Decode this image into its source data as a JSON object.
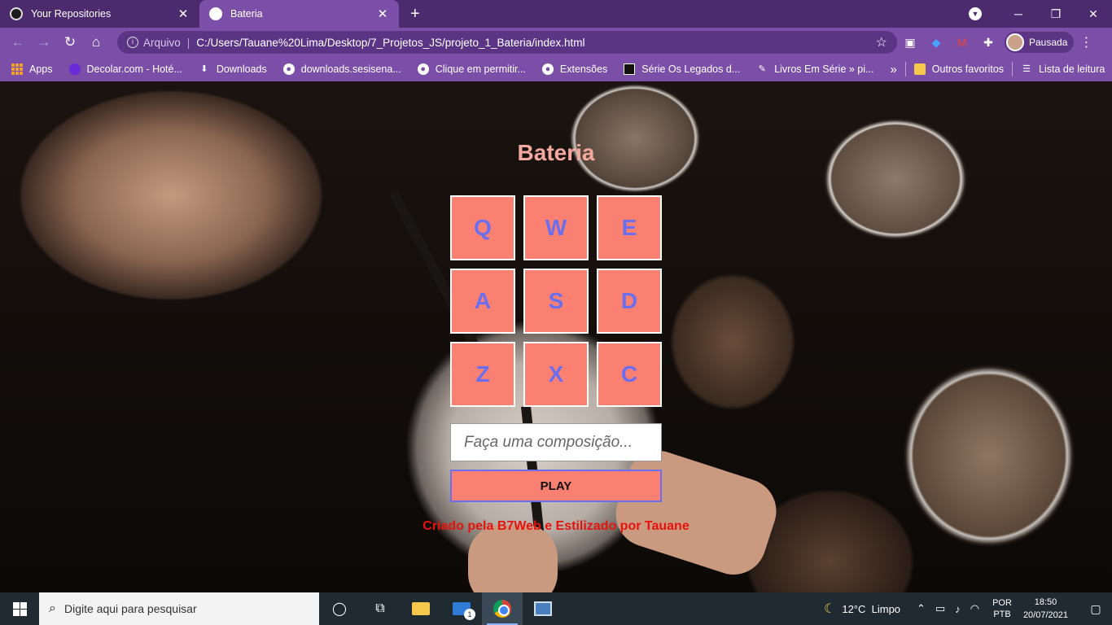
{
  "browser": {
    "tabs": [
      {
        "label": "Your Repositories",
        "active": false,
        "icon": "github-icon"
      },
      {
        "label": "Bateria",
        "active": true,
        "icon": "globe-icon"
      }
    ],
    "new_tab": "+",
    "address": {
      "scheme_label": "Arquivo",
      "url": "C:/Users/Tauane%20Lima/Desktop/7_Projetos_JS/projeto_1_Bateria/index.html"
    },
    "profile_label": "Pausada",
    "bookmarks": [
      {
        "label": "Apps",
        "icon": "apps-grid-icon"
      },
      {
        "label": "Decolar.com - Hoté...",
        "icon": "decolar-icon"
      },
      {
        "label": "Downloads",
        "icon": "download-icon"
      },
      {
        "label": "downloads.sesisena...",
        "icon": "globe-icon"
      },
      {
        "label": "Clique em permitir...",
        "icon": "globe-icon"
      },
      {
        "label": "Extensões",
        "icon": "globe-icon"
      },
      {
        "label": "Série Os Legados d...",
        "icon": "bookmark-square-icon"
      },
      {
        "label": "Livros Em Série » pi...",
        "icon": "pen-icon"
      }
    ],
    "more_bookmarks": "»",
    "other_favorites": "Outros favoritos",
    "reading_list": "Lista de leitura"
  },
  "page": {
    "title": "Bateria",
    "keys": [
      "Q",
      "W",
      "E",
      "A",
      "S",
      "D",
      "Z",
      "X",
      "C"
    ],
    "composition_placeholder": "Faça uma composição...",
    "play_label": "PLAY",
    "credit": "Criado pela B7Web e Estilizado por Tauane",
    "colors": {
      "key_bg": "#fa8072",
      "key_text": "#6b6fef",
      "title": "#f4a8a0",
      "credit": "#e8120c"
    }
  },
  "taskbar": {
    "search_placeholder": "Digite aqui para pesquisar",
    "weather_temp": "12°C",
    "weather_desc": "Limpo",
    "lang_1": "POR",
    "lang_2": "PTB",
    "time": "18:50",
    "date": "20/07/2021",
    "mail_badge": "1"
  }
}
